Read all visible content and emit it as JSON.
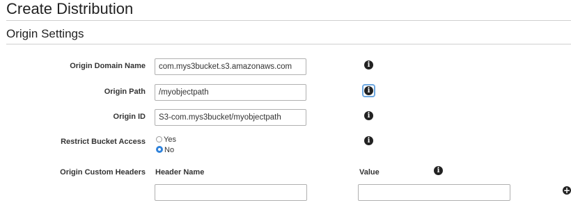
{
  "page": {
    "title": "Create Distribution",
    "section_title": "Origin Settings"
  },
  "fields": {
    "origin_domain_name": {
      "label": "Origin Domain Name",
      "value": "com.mys3bucket.s3.amazonaws.com"
    },
    "origin_path": {
      "label": "Origin Path",
      "value": "/myobjectpath"
    },
    "origin_id": {
      "label": "Origin ID",
      "value": "S3-com.mys3bucket/myobjectpath"
    },
    "restrict_bucket_access": {
      "label": "Restrict Bucket Access",
      "options": [
        "Yes",
        "No"
      ],
      "selected": "No"
    },
    "origin_custom_headers": {
      "label": "Origin Custom Headers",
      "header_name_col": "Header Name",
      "value_col": "Value",
      "header_name_value": "",
      "value_value": ""
    }
  },
  "icons": {
    "info": "info-icon",
    "add": "add-icon"
  },
  "colors": {
    "radio_selected": "#2f82db",
    "focus_ring": "#6da7e0"
  }
}
